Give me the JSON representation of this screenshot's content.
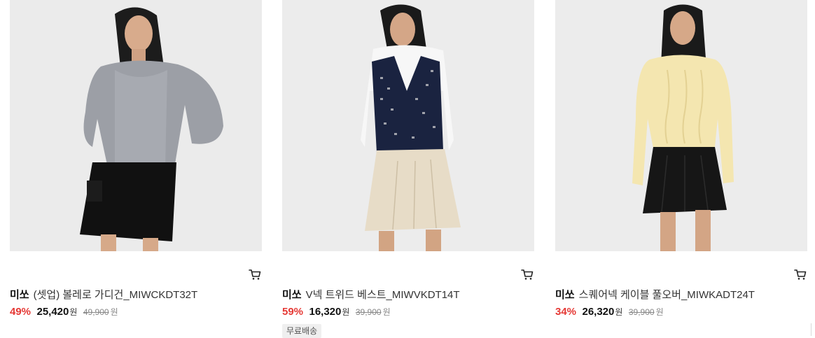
{
  "products": [
    {
      "brand": "미쏘",
      "name": "(셋업) 볼레로 가디건_MIWCKDT32T",
      "discount": "49%",
      "price": "25,420",
      "currency": "원",
      "original_price": "49,900",
      "original_currency": "원",
      "badge": "",
      "cart_icon": "cart-icon"
    },
    {
      "brand": "미쏘",
      "name": "V넥 트위드 베스트_MIWVKDT14T",
      "discount": "59%",
      "price": "16,320",
      "currency": "원",
      "original_price": "39,900",
      "original_currency": "원",
      "badge": "무료배송",
      "cart_icon": "cart-icon"
    },
    {
      "brand": "미쏘",
      "name": "스퀘어넥 케이블 풀오버_MIWKADT24T",
      "discount": "34%",
      "price": "26,320",
      "currency": "원",
      "original_price": "39,900",
      "original_currency": "원",
      "badge": "",
      "cart_icon": "cart-icon"
    }
  ],
  "colors": {
    "discount": "#e53935",
    "photo_background": "#ececec",
    "badge_background": "#efefef"
  }
}
